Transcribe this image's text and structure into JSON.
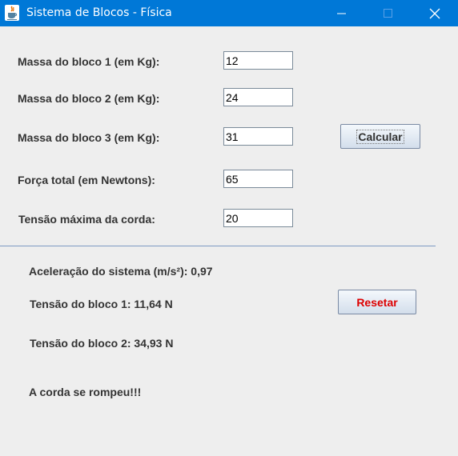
{
  "window": {
    "title": "Sistema de Blocos - Física",
    "colors": {
      "titlebar": "#0078d7",
      "background": "#eeeeee"
    },
    "controls": {
      "minimize": "minimize-icon",
      "maximize": "maximize-icon",
      "close": "close-icon"
    }
  },
  "form": {
    "mass1_label": "Massa do bloco 1 (em Kg):",
    "mass1_value": "12",
    "mass2_label": "Massa do bloco 2 (em Kg):",
    "mass2_value": "24",
    "mass3_label": "Massa do bloco 3 (em Kg):",
    "mass3_value": "31",
    "force_label": "Força total (em Newtons):",
    "force_value": "65",
    "max_tension_label": "Tensão máxima da corda:",
    "max_tension_value": "20",
    "calculate_label": "Calcular"
  },
  "results": {
    "acceleration": "Aceleração do sistema (m/s²): 0,97",
    "tension1": "Tensão do bloco 1: 11,64 N",
    "tension2": "Tensão do bloco 2: 34,93 N",
    "status": "A corda se rompeu!!!",
    "reset_label": "Resetar",
    "reset_color": "#dd0000"
  }
}
